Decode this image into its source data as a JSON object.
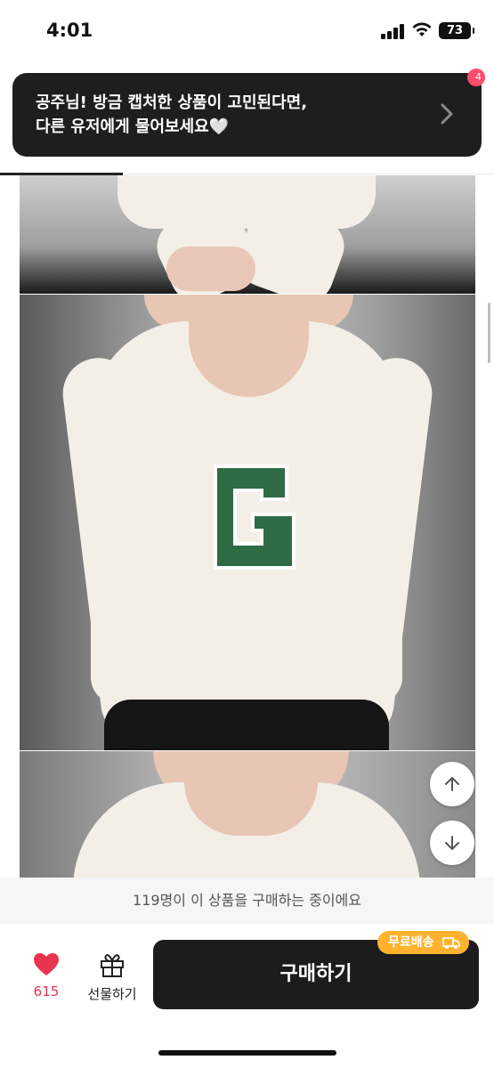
{
  "status_bar": {
    "time": "4:01",
    "battery": "73"
  },
  "banner": {
    "line1": "공주님! 방금 캡처한 상품이 고민된다면,",
    "line2": "다른 유저에게 물어보세요🤍",
    "badge": "4"
  },
  "gallery": {
    "images": [
      "product-photo-hands",
      "product-photo-sweater-front",
      "product-photo-sweater-neckline"
    ]
  },
  "bottom_bar": {
    "notice": "119명이 이 상품을 구매하는 중이에요",
    "like_count": "615",
    "gift_label": "선물하기",
    "buy_label": "구매하기",
    "shipping_badge": "무료배송"
  },
  "colors": {
    "accent": "#e8344e",
    "shipping": "#ffb22e",
    "button": "#1c1c1c"
  }
}
